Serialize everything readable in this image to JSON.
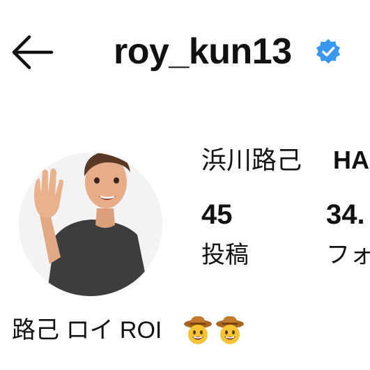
{
  "header": {
    "back_icon": "arrow-left-icon",
    "username": "roy_kun13",
    "verified_icon": "verified-badge-icon",
    "verified_color": "#3897f0"
  },
  "profile": {
    "display_name": "浜川路己",
    "display_name_secondary": "HA",
    "stats": [
      {
        "count": "45",
        "label": "投稿"
      },
      {
        "count": "34.",
        "label": "フォ"
      }
    ],
    "bio_text": "路己 ロイ ROI",
    "bio_emojis": [
      "cowboy-face-icon",
      "cowboy-face-icon"
    ]
  }
}
